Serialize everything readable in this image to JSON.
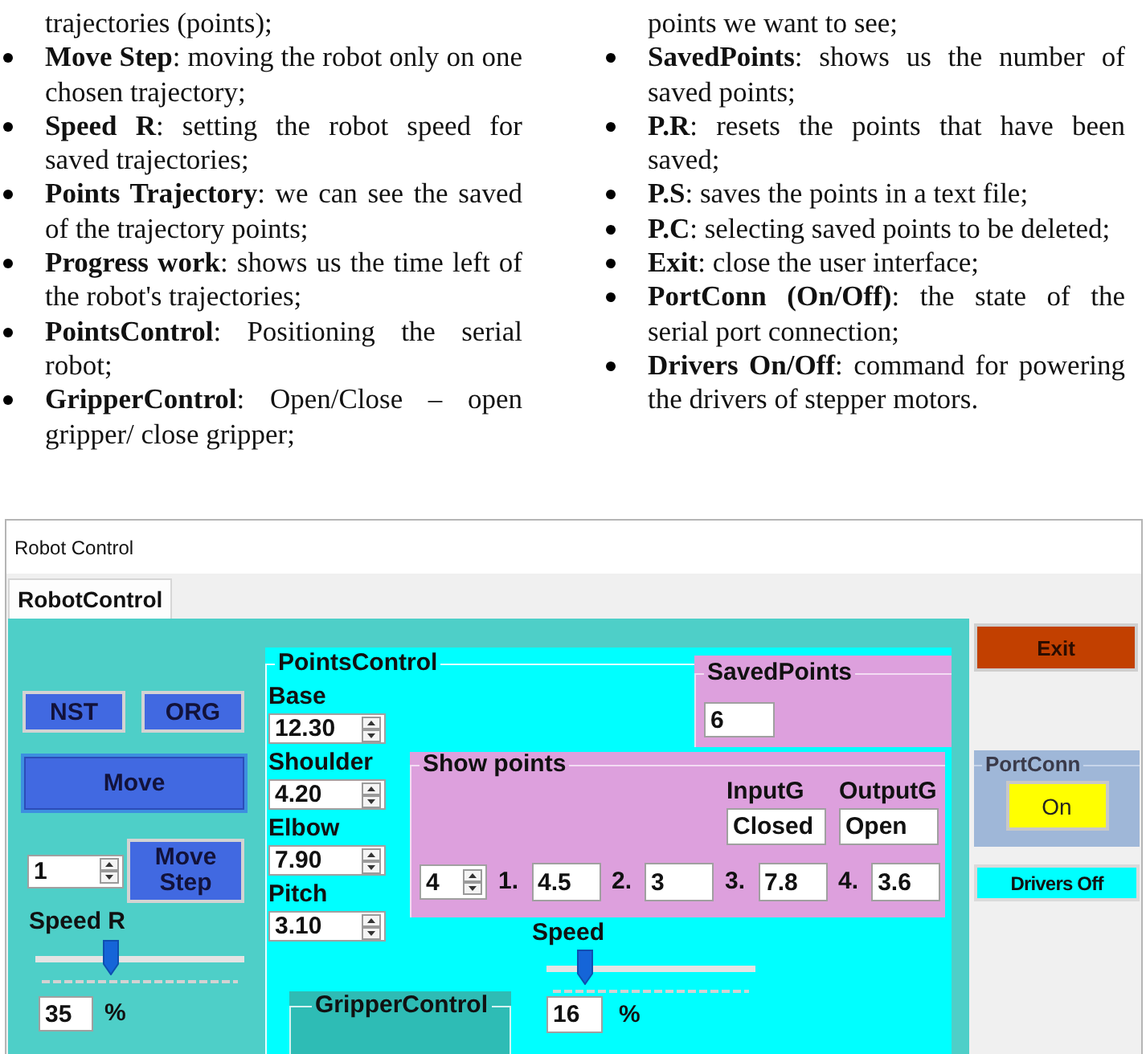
{
  "document": {
    "columns": [
      {
        "items": [
          {
            "kind": "continuation",
            "text": "trajectories (points);"
          },
          {
            "kind": "bullet",
            "text": "**Move Step**: moving the robot only on one chosen trajectory;"
          },
          {
            "kind": "bullet",
            "text": "**Speed R**: setting the robot speed for saved trajectories;"
          },
          {
            "kind": "bullet",
            "text": "**Points Trajectory**: we can see the saved of the trajectory points;"
          },
          {
            "kind": "bullet",
            "text": "**Progress work**: shows us the time left of the robot's trajectories;"
          },
          {
            "kind": "bullet",
            "text": "**PointsControl**: Positioning the serial robot;"
          },
          {
            "kind": "bullet",
            "text": "**GripperControl**: Open/Close – open gripper/ close gripper;"
          }
        ]
      },
      {
        "items": [
          {
            "kind": "continuation",
            "text": "points we want to see;"
          },
          {
            "kind": "bullet",
            "text": "**SavedPoints**: shows us the number of saved points;"
          },
          {
            "kind": "bullet",
            "text": "**P.R**: resets the points that have been saved;"
          },
          {
            "kind": "bullet",
            "text": "**P.S**: saves the points in a text file;"
          },
          {
            "kind": "bullet",
            "text": "**P.C**: selecting saved points to be deleted;"
          },
          {
            "kind": "bullet",
            "text": "**Exit**: close the user interface;"
          },
          {
            "kind": "bullet",
            "text": "**PortConn (On/Off)**: the state of the serial port connection;"
          },
          {
            "kind": "bullet",
            "text": "**Drivers On/Off**: command for powering the drivers of stepper motors."
          }
        ]
      }
    ]
  },
  "window": {
    "title": "Robot Control"
  },
  "tabs": [
    {
      "label": "RobotControl",
      "selected": true
    }
  ],
  "left_panel": {
    "buttons": [
      "NST",
      "ORG"
    ],
    "move_button": "Move",
    "step_value": "1",
    "move_step_button": "Move Step",
    "speed_r": {
      "label": "Speed R",
      "level": 0.35,
      "value": "35",
      "unit": "%"
    }
  },
  "points_control": {
    "title": "PointsControl",
    "joints": [
      {
        "label": "Base",
        "value": "12.30"
      },
      {
        "label": "Shoulder",
        "value": "4.20"
      },
      {
        "label": "Elbow",
        "value": "7.90"
      },
      {
        "label": "Pitch",
        "value": "3.10"
      }
    ]
  },
  "saved_points": {
    "title": "SavedPoints",
    "value": "6"
  },
  "show_points": {
    "title": "Show points",
    "gripper": [
      {
        "label": "InputG",
        "value": "Closed"
      },
      {
        "label": "OutputG",
        "value": "Open"
      }
    ],
    "count": "4",
    "points": [
      {
        "index": "1.",
        "value": "4.5"
      },
      {
        "index": "2.",
        "value": "3"
      },
      {
        "index": "3.",
        "value": "7.8"
      },
      {
        "index": "4.",
        "value": "3.6"
      }
    ]
  },
  "speed": {
    "label": "Speed",
    "level": 0.16,
    "value": "16",
    "unit": "%"
  },
  "gripper_control": {
    "title": "GripperControl"
  },
  "side": {
    "exit_button": "Exit",
    "port_conn": {
      "title": "PortConn",
      "button": "On"
    },
    "drivers_button": "Drivers Off"
  }
}
